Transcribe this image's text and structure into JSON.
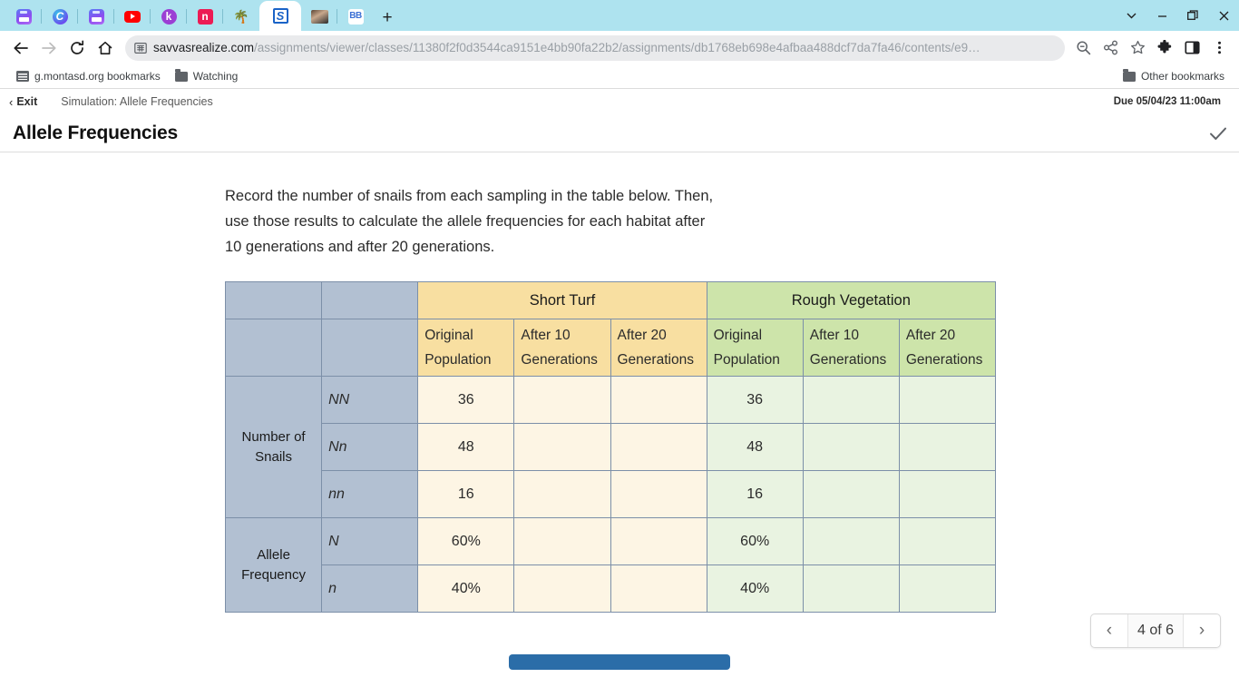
{
  "browser": {
    "tabs": [
      {
        "name": "tab-printer-1",
        "icon": "printer-icon",
        "active": false
      },
      {
        "name": "tab-c-app",
        "icon": "letter-c-icon",
        "active": false
      },
      {
        "name": "tab-printer-2",
        "icon": "printer-icon",
        "active": false
      },
      {
        "name": "tab-youtube",
        "icon": "youtube-icon",
        "active": false
      },
      {
        "name": "tab-k-app",
        "icon": "letter-k-icon",
        "active": false
      },
      {
        "name": "tab-n-app",
        "icon": "letter-n-icon",
        "active": false
      },
      {
        "name": "tab-palm",
        "icon": "palm-tree-icon",
        "active": false
      },
      {
        "name": "tab-savvas",
        "icon": "savvas-s-icon",
        "active": true
      },
      {
        "name": "tab-photo",
        "icon": "photo-icon",
        "active": false
      },
      {
        "name": "tab-bb-app",
        "icon": "bb-icon",
        "active": false
      }
    ],
    "new_tab_label": "+",
    "window_controls": {
      "tab_search": "⌄",
      "minimize": "—",
      "maximize": "❐",
      "close": "✕"
    },
    "omnibox": {
      "url_bold": "savvasrealize.com",
      "url_rest": "/assignments/viewer/classes/11380f2f0d3544ca9151e4bb90fa22b2/assignments/db1768eb698e4afbaa488dcf7da7fa46/contents/e9…"
    },
    "bookmarks": [
      {
        "label": "g.montasd.org bookmarks",
        "icon": "bookmark-site-icon"
      },
      {
        "label": "Watching",
        "icon": "folder-icon"
      }
    ],
    "other_bookmarks": {
      "label": "Other bookmarks",
      "icon": "folder-icon"
    }
  },
  "app": {
    "exit_label": "Exit",
    "breadcrumb": "Simulation: Allele Frequencies",
    "due": "Due 05/04/23 11:00am",
    "page_title": "Allele Frequencies",
    "instructions": "Record the number of snails from each sampling in the table below. Then, use those results to calculate the allele frequencies for each habitat after 10 generations and after 20 generations.",
    "pager": {
      "prev": "‹",
      "label": "4 of 6",
      "next": "›"
    }
  },
  "table": {
    "groups": [
      {
        "label": "Short Turf",
        "theme": "turf"
      },
      {
        "label": "Rough Vegetation",
        "theme": "veg"
      }
    ],
    "subheaders": [
      "Original Population",
      "After 10 Generations",
      "After 20 Generations"
    ],
    "row_groups": [
      {
        "label": "Number of Snails",
        "rows": [
          {
            "geno": "NN",
            "turf": [
              "36",
              "",
              ""
            ],
            "veg": [
              "36",
              "",
              ""
            ]
          },
          {
            "geno": "Nn",
            "turf": [
              "48",
              "",
              ""
            ],
            "veg": [
              "48",
              "",
              ""
            ]
          },
          {
            "geno": "nn",
            "turf": [
              "16",
              "",
              ""
            ],
            "veg": [
              "16",
              "",
              ""
            ]
          }
        ]
      },
      {
        "label": "Allele Frequency",
        "rows": [
          {
            "geno": "N",
            "turf": [
              "60%",
              "",
              ""
            ],
            "veg": [
              "60%",
              "",
              ""
            ]
          },
          {
            "geno": "n",
            "turf": [
              "40%",
              "",
              ""
            ],
            "veg": [
              "40%",
              "",
              ""
            ]
          }
        ]
      }
    ]
  },
  "colors": {
    "tabstrip": "#aee3ef",
    "label_column": "#b2c0d2",
    "short_turf_header": "#f8dfa1",
    "short_turf_cell": "#fdf5e4",
    "rough_vegetation_header": "#cde4aa",
    "rough_vegetation_cell": "#e9f3e1",
    "table_border": "#7c8fa8",
    "submit_button": "#2b6da8"
  }
}
